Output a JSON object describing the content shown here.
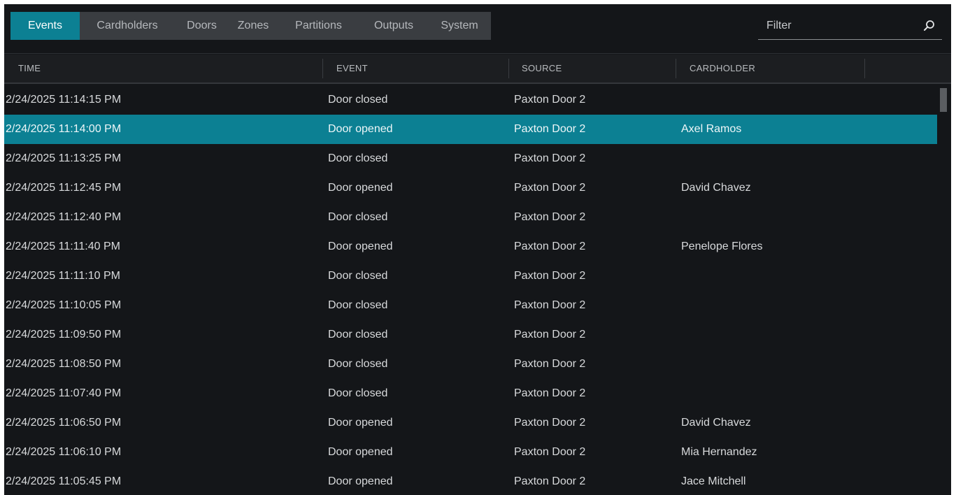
{
  "tabs": [
    {
      "label": "Events",
      "active": true
    },
    {
      "label": "Cardholders",
      "active": false
    },
    {
      "label": "Doors",
      "active": false
    },
    {
      "label": "Zones",
      "active": false
    },
    {
      "label": "Partitions",
      "active": false
    },
    {
      "label": "Outputs",
      "active": false
    },
    {
      "label": "System",
      "active": false
    }
  ],
  "filter": {
    "placeholder": "Filter",
    "icon": "search-icon"
  },
  "columns": [
    "TIME",
    "EVENT",
    "SOURCE",
    "CARDHOLDER"
  ],
  "rows": [
    {
      "time": "2/24/2025 11:14:15 PM",
      "event": "Door closed",
      "source": "Paxton Door 2",
      "cardholder": ""
    },
    {
      "time": "2/24/2025 11:14:00 PM",
      "event": "Door opened",
      "source": "Paxton Door 2",
      "cardholder": "Axel Ramos"
    },
    {
      "time": "2/24/2025 11:13:25 PM",
      "event": "Door closed",
      "source": "Paxton Door 2",
      "cardholder": ""
    },
    {
      "time": "2/24/2025 11:12:45 PM",
      "event": "Door opened",
      "source": "Paxton Door 2",
      "cardholder": "David Chavez"
    },
    {
      "time": "2/24/2025 11:12:40 PM",
      "event": "Door closed",
      "source": "Paxton Door 2",
      "cardholder": ""
    },
    {
      "time": "2/24/2025 11:11:40 PM",
      "event": "Door opened",
      "source": "Paxton Door 2",
      "cardholder": "Penelope Flores"
    },
    {
      "time": "2/24/2025 11:11:10 PM",
      "event": "Door closed",
      "source": "Paxton Door 2",
      "cardholder": ""
    },
    {
      "time": "2/24/2025 11:10:05 PM",
      "event": "Door closed",
      "source": "Paxton Door 2",
      "cardholder": ""
    },
    {
      "time": "2/24/2025 11:09:50 PM",
      "event": "Door closed",
      "source": "Paxton Door 2",
      "cardholder": ""
    },
    {
      "time": "2/24/2025 11:08:50 PM",
      "event": "Door closed",
      "source": "Paxton Door 2",
      "cardholder": ""
    },
    {
      "time": "2/24/2025 11:07:40 PM",
      "event": "Door closed",
      "source": "Paxton Door 2",
      "cardholder": ""
    },
    {
      "time": "2/24/2025 11:06:50 PM",
      "event": "Door opened",
      "source": "Paxton Door 2",
      "cardholder": "David Chavez"
    },
    {
      "time": "2/24/2025 11:06:10 PM",
      "event": "Door opened",
      "source": "Paxton Door 2",
      "cardholder": "Mia Hernandez"
    },
    {
      "time": "2/24/2025 11:05:45 PM",
      "event": "Door opened",
      "source": "Paxton Door 2",
      "cardholder": "Jace Mitchell"
    }
  ],
  "selected_row": 1,
  "colors": {
    "accent": "#0c8093",
    "background": "#141619",
    "tab_bar": "#3a3d41",
    "header": "#1c1e21"
  }
}
